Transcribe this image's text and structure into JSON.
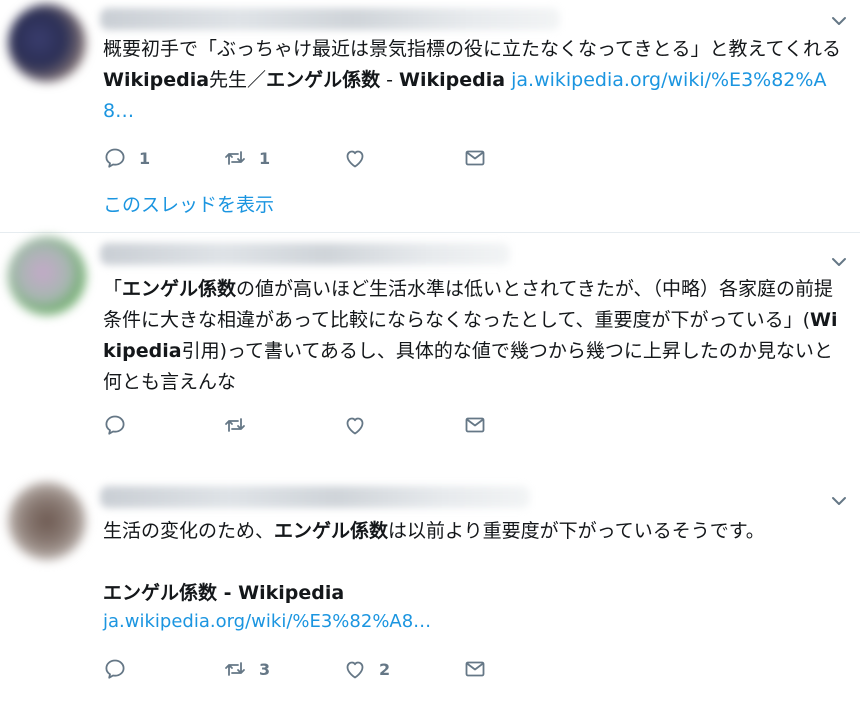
{
  "colors": {
    "accent": "#1b95e0",
    "text": "#14171a",
    "muted": "#657786",
    "divider": "#e6ecf0"
  },
  "tweets": [
    {
      "body": [
        {
          "t": "概要初手で「ぶっちゃけ最近は景気指標の役に立たなくなってきとる」と教えてくれる"
        },
        {
          "t": "Wikipedia",
          "b": true
        },
        {
          "t": "先生／"
        },
        {
          "t": "エンゲル係数",
          "b": true
        },
        {
          "t": " - "
        },
        {
          "t": "Wikipedia",
          "b": true
        },
        {
          "t": " "
        },
        {
          "t": "ja.wikipedia.org/wiki/%E3%82%A8…",
          "l": true
        }
      ],
      "actions": {
        "reply": "1",
        "retweet": "1",
        "like": "",
        "dm": ""
      },
      "thread_link": "このスレッドを表示"
    },
    {
      "body": [
        {
          "t": "「"
        },
        {
          "t": "エンゲル係数",
          "b": true
        },
        {
          "t": "の値が高いほど生活水準は低いとされてきたが、（中略）各家庭の前提条件に大きな相違があって比較にならなくなったとして、重要度が下がっている」("
        },
        {
          "t": "Wikipedia",
          "b": true
        },
        {
          "t": "引用)って書いてあるし、具体的な値で幾つから幾つに上昇したのか見ないと何とも言えんな"
        }
      ],
      "actions": {
        "reply": "",
        "retweet": "",
        "like": "",
        "dm": ""
      }
    },
    {
      "body": [
        {
          "t": "生活の変化のため、"
        },
        {
          "t": "エンゲル係数",
          "b": true
        },
        {
          "t": "は以前より重要度が下がっているそうです。"
        }
      ],
      "card": {
        "title": "エンゲル係数",
        "title_suffix": " - Wikipedia",
        "url": "ja.wikipedia.org/wiki/%E3%82%A8…"
      },
      "actions": {
        "reply": "",
        "retweet": "3",
        "like": "2",
        "dm": ""
      }
    }
  ],
  "icons": [
    "reply-icon",
    "retweet-icon",
    "like-icon",
    "message-icon",
    "chevron-down-icon"
  ]
}
